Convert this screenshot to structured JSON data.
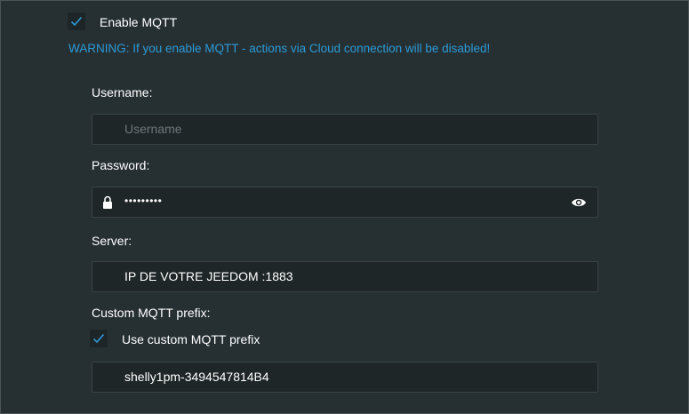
{
  "mqtt": {
    "enabled": true,
    "enable_label": "Enable MQTT",
    "warning": "WARNING: If you enable MQTT - actions via Cloud connection will be disabled!"
  },
  "username": {
    "label": "Username:",
    "value": "",
    "placeholder": "Username"
  },
  "password": {
    "label": "Password:",
    "masked_value": "•••••••••",
    "lock_icon": "lock-icon",
    "toggle_icon": "eye-icon"
  },
  "server": {
    "label": "Server:",
    "value": "IP DE VOTRE JEEDOM :1883"
  },
  "prefix": {
    "label": "Custom MQTT prefix:",
    "use_custom_checked": true,
    "use_custom_label": "Use custom MQTT prefix",
    "value": "shelly1pm-3494547814B4"
  },
  "colors": {
    "background": "#263033",
    "field_background": "#1f2628",
    "accent": "#2d9ad6",
    "text": "#ffffff",
    "placeholder": "#6d7679"
  }
}
